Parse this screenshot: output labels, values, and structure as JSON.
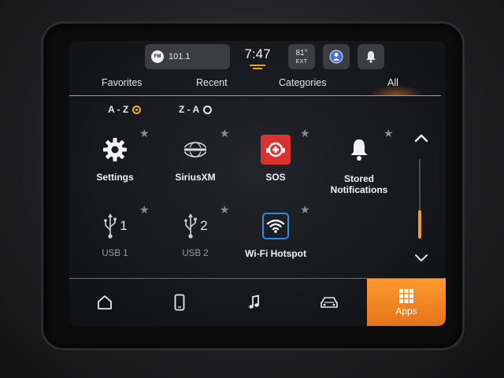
{
  "status_bar": {
    "radio_badge": "FM",
    "radio_frequency": "101.1",
    "clock": "7:47",
    "temperature": "81°",
    "temperature_label": "EXT"
  },
  "tabs": [
    {
      "label": "Favorites",
      "active": false
    },
    {
      "label": "Recent",
      "active": false
    },
    {
      "label": "Categories",
      "active": false
    },
    {
      "label": "All",
      "active": true
    }
  ],
  "sort": {
    "a_z_label": "A - Z",
    "z_a_label": "Z - A",
    "selected": "A - Z"
  },
  "apps": [
    {
      "label": "Settings",
      "icon": "gear-icon",
      "label_style": "bright"
    },
    {
      "label": "SiriusXM",
      "icon": "siriusxm-logo-icon",
      "label_style": "bright"
    },
    {
      "label": "SOS",
      "icon": "sos-icon",
      "label_style": "bright"
    },
    {
      "label": "Stored Notifications",
      "icon": "bell-icon",
      "label_style": "bright"
    },
    {
      "label": "USB 1",
      "icon": "usb-1-icon",
      "usb_number": "1",
      "label_style": "dim"
    },
    {
      "label": "USB 2",
      "icon": "usb-2-icon",
      "usb_number": "2",
      "label_style": "dim"
    },
    {
      "label": "Wi-Fi Hotspot",
      "icon": "wifi-icon",
      "label_style": "bright"
    }
  ],
  "scroll_position": 0.95,
  "dock": [
    {
      "label": "",
      "icon": "home-icon"
    },
    {
      "label": "",
      "icon": "phone-icon"
    },
    {
      "label": "",
      "icon": "music-note-icon"
    },
    {
      "label": "",
      "icon": "car-icon"
    },
    {
      "label": "Apps",
      "icon": "apps-grid-icon",
      "active": true
    }
  ],
  "colors": {
    "accent": "#f0a020",
    "sos": "#d8332e",
    "wifi_outline": "#2d8be0",
    "dock_active": "#f08a26"
  }
}
